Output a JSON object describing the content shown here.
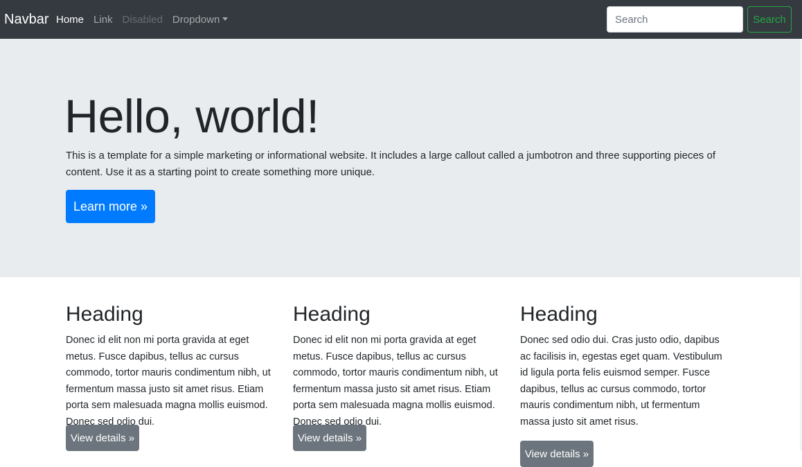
{
  "navbar": {
    "brand": "Navbar",
    "links": [
      {
        "label": "Home",
        "state": "active"
      },
      {
        "label": "Link",
        "state": "normal"
      },
      {
        "label": "Disabled",
        "state": "disabled"
      },
      {
        "label": "Dropdown",
        "state": "dropdown"
      }
    ],
    "search_placeholder": "Search",
    "search_button": "Search",
    "colors": {
      "background": "#343a40",
      "search_button": "#28a745"
    }
  },
  "jumbotron": {
    "title": "Hello, world!",
    "lead": "This is a template for a simple marketing or informational website. It includes a large callout called a jumbotron and three supporting pieces of content. Use it as a starting point to create something more unique.",
    "button": "Learn more »",
    "colors": {
      "background": "#e9ecef",
      "button": "#007bff"
    }
  },
  "columns": [
    {
      "heading": "Heading",
      "text": "Donec id elit non mi porta gravida at eget metus. Fusce dapibus, tellus ac cursus commodo, tortor mauris condimentum nibh, ut fermentum massa justo sit amet risus. Etiam porta sem malesuada magna mollis euismod. Donec sed odio dui.",
      "button": "View details »"
    },
    {
      "heading": "Heading",
      "text": "Donec id elit non mi porta gravida at eget metus. Fusce dapibus, tellus ac cursus commodo, tortor mauris condimentum nibh, ut fermentum massa justo sit amet risus. Etiam porta sem malesuada magna mollis euismod. Donec sed odio dui.",
      "button": "View details »"
    },
    {
      "heading": "Heading",
      "text": "Donec sed odio dui. Cras justo odio, dapibus ac facilisis in, egestas eget quam. Vestibulum id ligula porta felis euismod semper. Fusce dapibus, tellus ac cursus commodo, tortor mauris condimentum nibh, ut fermentum massa justo sit amet risus.",
      "button": "View details »"
    }
  ]
}
